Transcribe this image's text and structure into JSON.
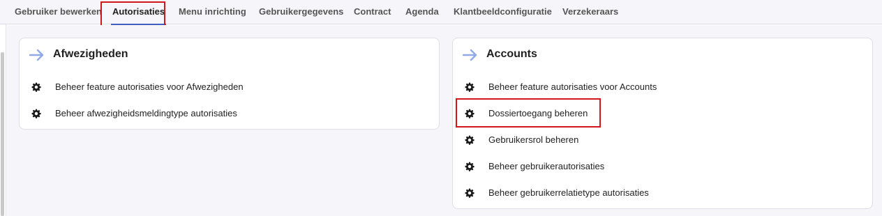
{
  "tabs": [
    {
      "label": "Gebruiker bewerken"
    },
    {
      "label": "Autorisaties"
    },
    {
      "label": "Menu inrichting"
    },
    {
      "label": "Gebruikergegevens"
    },
    {
      "label": "Contract"
    },
    {
      "label": "Agenda"
    },
    {
      "label": "Klantbeeldconfiguratie"
    },
    {
      "label": "Verzekeraars"
    }
  ],
  "active_tab": "Autorisaties",
  "cards": [
    {
      "title": "Afwezigheden",
      "items": [
        {
          "label": "Beheer feature autorisaties voor Afwezigheden"
        },
        {
          "label": "Beheer afwezigheidsmeldingtype autorisaties"
        }
      ]
    },
    {
      "title": "Accounts",
      "items": [
        {
          "label": "Beheer feature autorisaties voor Accounts"
        },
        {
          "label": "Dossiertoegang beheren"
        },
        {
          "label": "Gebruikersrol beheren"
        },
        {
          "label": "Beheer gebruikerautorisaties"
        },
        {
          "label": "Beheer gebruikerrelatietype autorisaties"
        }
      ]
    }
  ],
  "highlighted": [
    "Autorisaties",
    "Dossiertoegang beheren"
  ],
  "colors": {
    "accent": "#3f5fbf",
    "arrow": "#8fa8e6",
    "highlight": "#d0181b",
    "background": "#f6f6fa"
  },
  "icons": {
    "card_header": "arrow-right-icon",
    "item": "gear-icon"
  }
}
